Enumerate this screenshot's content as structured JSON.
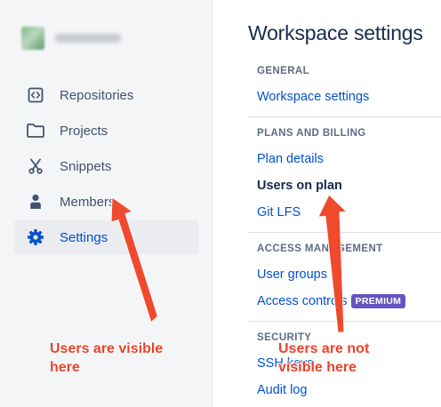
{
  "sidebar": {
    "items": [
      {
        "label": "Repositories",
        "icon": "repository-icon",
        "active": false
      },
      {
        "label": "Projects",
        "icon": "folder-icon",
        "active": false
      },
      {
        "label": "Snippets",
        "icon": "scissors-icon",
        "active": false
      },
      {
        "label": "Members",
        "icon": "person-icon",
        "active": false
      },
      {
        "label": "Settings",
        "icon": "gear-icon",
        "active": true
      }
    ]
  },
  "main": {
    "title": "Workspace settings",
    "sections": [
      {
        "heading": "GENERAL",
        "links": [
          "Workspace settings"
        ]
      },
      {
        "heading": "PLANS AND BILLING",
        "links": [
          "Plan details",
          "Users on plan",
          "Git LFS"
        ],
        "current": "Users on plan"
      },
      {
        "heading": "ACCESS MANAGEMENT",
        "links": [
          "User groups",
          "Access controls"
        ],
        "badge": "PREMIUM"
      },
      {
        "heading": "SECURITY",
        "links": [
          "SSH keys",
          "Audit log"
        ]
      }
    ]
  },
  "annotations": {
    "left_note": [
      "Users are visible",
      "here"
    ],
    "right_note": [
      "Users are not",
      "visible here"
    ],
    "color": "#e8432b"
  },
  "colors": {
    "link": "#0052cc",
    "badge": "#6554c0",
    "sidebar_bg": "#f4f5f7"
  }
}
